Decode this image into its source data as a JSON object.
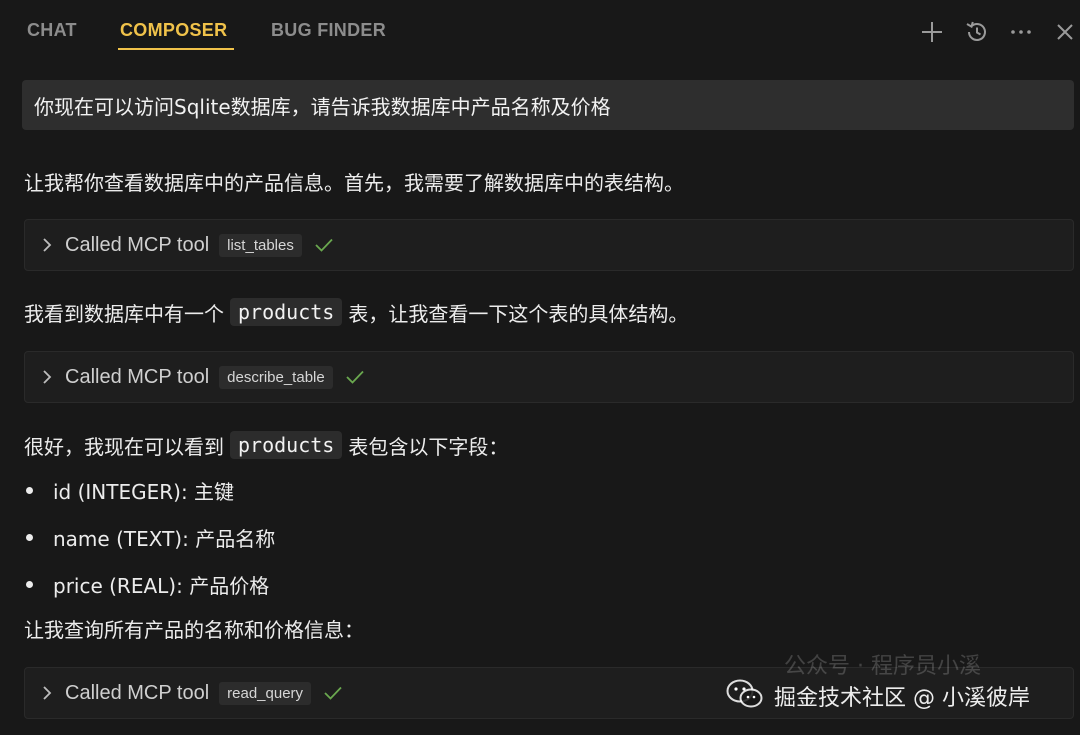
{
  "tabs": [
    {
      "label": "CHAT",
      "active": false
    },
    {
      "label": "COMPOSER",
      "active": true
    },
    {
      "label": "BUG FINDER",
      "active": false
    }
  ],
  "toolbar_icons": [
    "plus-icon",
    "history-icon",
    "more-icon",
    "close-icon"
  ],
  "colors": {
    "accent": "#f0c24a",
    "check": "#6aa84f"
  },
  "user_prompt": "你现在可以访问Sqlite数据库，请告诉我数据库中产品名称及价格",
  "messages": {
    "intro": "让我帮你查看数据库中的产品信息。首先，我需要了解数据库中的表结构。",
    "tool_label": "Called MCP tool",
    "tool1": "list_tables",
    "found_pre": "我看到数据库中有一个",
    "found_code": "products",
    "found_post": "表，让我查看一下这个表的具体结构。",
    "tool2": "describe_table",
    "fields_pre": "很好，我现在可以看到",
    "fields_code": "products",
    "fields_post": "表包含以下字段：",
    "fields": [
      "id (INTEGER): 主键",
      "name (TEXT): 产品名称",
      "price (REAL): 产品价格"
    ],
    "query_intro": "让我查询所有产品的名称和价格信息：",
    "tool3": "read_query"
  },
  "watermark": {
    "text": "掘金技术社区 @ 小溪彼岸",
    "ghost": "公众号 · 程序员小溪"
  }
}
